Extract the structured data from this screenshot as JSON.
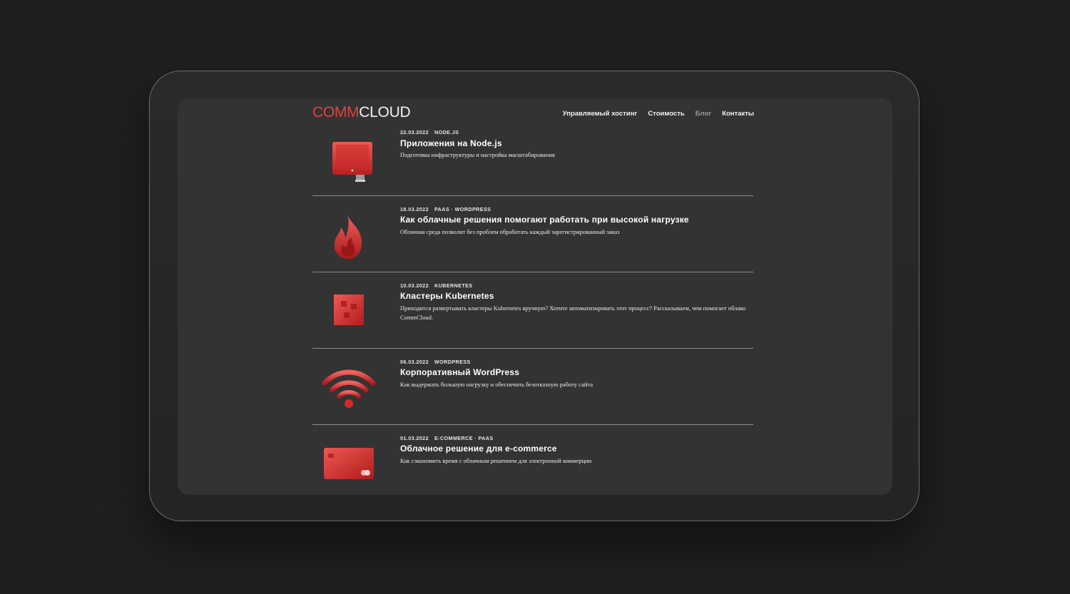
{
  "brand": {
    "logo_part1": "COMM",
    "logo_part2": "CLOUD"
  },
  "nav": [
    {
      "label": "Управляемый хостинг",
      "active": false
    },
    {
      "label": "Стоимость",
      "active": false
    },
    {
      "label": "Блог",
      "active": true
    },
    {
      "label": "Контакты",
      "active": false
    }
  ],
  "posts": [
    {
      "date": "22.03.2022",
      "tags": "NODE.JS",
      "title": "Приложения на Node.js",
      "description": "Подготовка инфраструктуры и настройка масштабирования",
      "icon": "monitor-icon"
    },
    {
      "date": "18.03.2022",
      "tags": "PAAS · WORDPRESS",
      "title": "Как облачные решения помогают работать при высокой нагрузке",
      "description": "Облачная среда позволит без проблем обработать каждый зарегистрированный заказ",
      "icon": "flame-icon"
    },
    {
      "date": "10.03.2022",
      "tags": "KUBERNETES",
      "title": "Кластеры Kubernetes",
      "description": "Приходится развертывать кластеры Kubernetes вручную? Хотите автоматизировать этот процесс? Рассказываем, чем помогает облако CommCloud.",
      "icon": "cube-icon"
    },
    {
      "date": "06.03.2022",
      "tags": "WORDPRESS",
      "title": "Корпоративный WordPress",
      "description": "Как выдержать большую нагрузку и обеспечить безотказную работу сайта",
      "icon": "wifi-icon"
    },
    {
      "date": "01.03.2022",
      "tags": "E-COMMERCE · PAAS",
      "title": "Облачное решение для e-commerce",
      "description": "Как сэкономить время с облачным решением для электронной коммерции",
      "icon": "credit-card-icon"
    }
  ],
  "colors": {
    "accent": "#e0413e",
    "page_bg": "#1f1f1f",
    "screen_bg": "#333333"
  }
}
